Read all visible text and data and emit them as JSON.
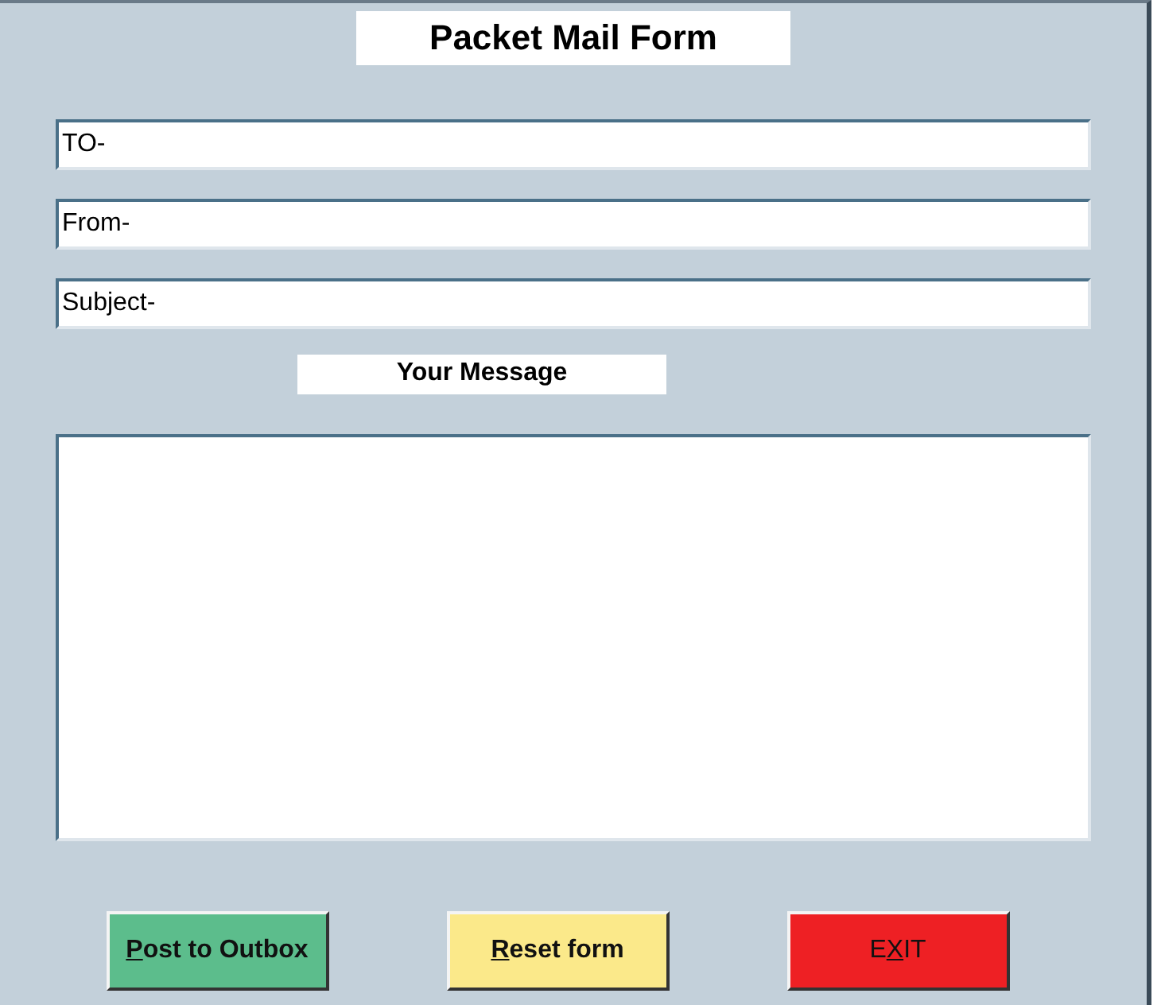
{
  "title": "Packet Mail Form",
  "fields": [
    {
      "value": "TO-"
    },
    {
      "value": "From-"
    },
    {
      "value": "Subject-"
    }
  ],
  "message": {
    "label": "Your Message"
  },
  "buttons": [
    {
      "kind": "post",
      "access_key": "P",
      "after": "ost to Outbox"
    },
    {
      "kind": "reset",
      "access_key": "R",
      "after": "eset form"
    },
    {
      "kind": "exit",
      "before": "E",
      "access_key": "X",
      "after": "IT"
    }
  ]
}
